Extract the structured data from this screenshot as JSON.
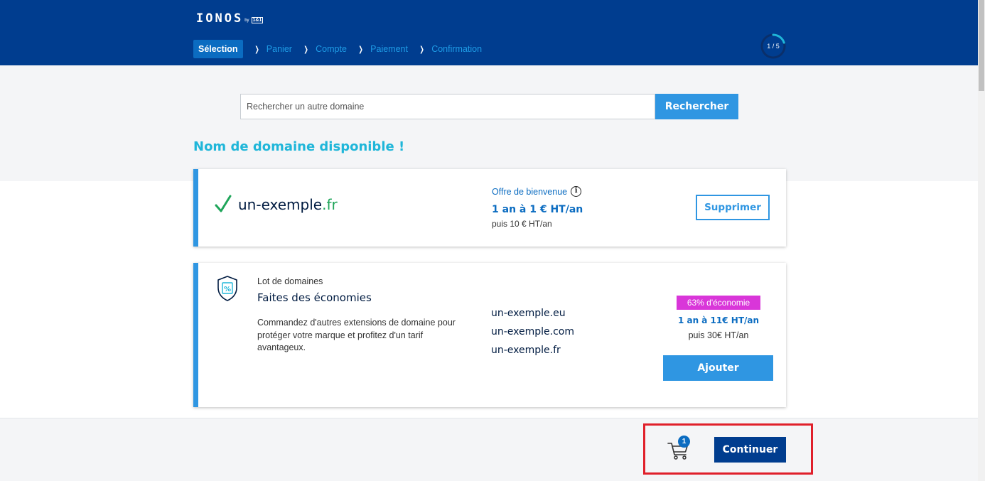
{
  "header": {
    "logo": "IONOS",
    "logo_by": "by",
    "logo_partner": "1&1",
    "steps": [
      "Sélection",
      "Panier",
      "Compte",
      "Paiement",
      "Confirmation"
    ],
    "progress_label": "1 / 5",
    "progress_value": 0.2
  },
  "search": {
    "placeholder": "Rechercher un autre domaine",
    "button_label": "Rechercher"
  },
  "availability_title": "Nom de domaine disponible !",
  "domain_card": {
    "name": "un-exemple",
    "tld": ".fr",
    "offer_label": "Offre de bienvenue",
    "price": "1 an à 1 € HT/an",
    "price_then": "puis 10 € HT/an",
    "remove_label": "Supprimer"
  },
  "bundle_card": {
    "label": "Lot de domaines",
    "title": "Faites des économies",
    "description": "Commandez d'autres extensions de domaine pour protéger votre marque et profitez d'un tarif avantageux.",
    "domains": [
      "un-exemple.eu",
      "un-exemple.com",
      "un-exemple.fr"
    ],
    "savings_badge": "63% d'économie",
    "price": "1 an à 11€ HT/an",
    "price_then": "puis 30€ HT/an",
    "add_label": "Ajouter"
  },
  "footer": {
    "cart_count": "1",
    "continue_label": "Continuer"
  },
  "colors": {
    "header_bg": "#003d8f",
    "accent": "#2f96e2",
    "title": "#1fb6d9",
    "success": "#1fa55a",
    "badge": "#d936d9",
    "highlight": "#e0202b"
  }
}
